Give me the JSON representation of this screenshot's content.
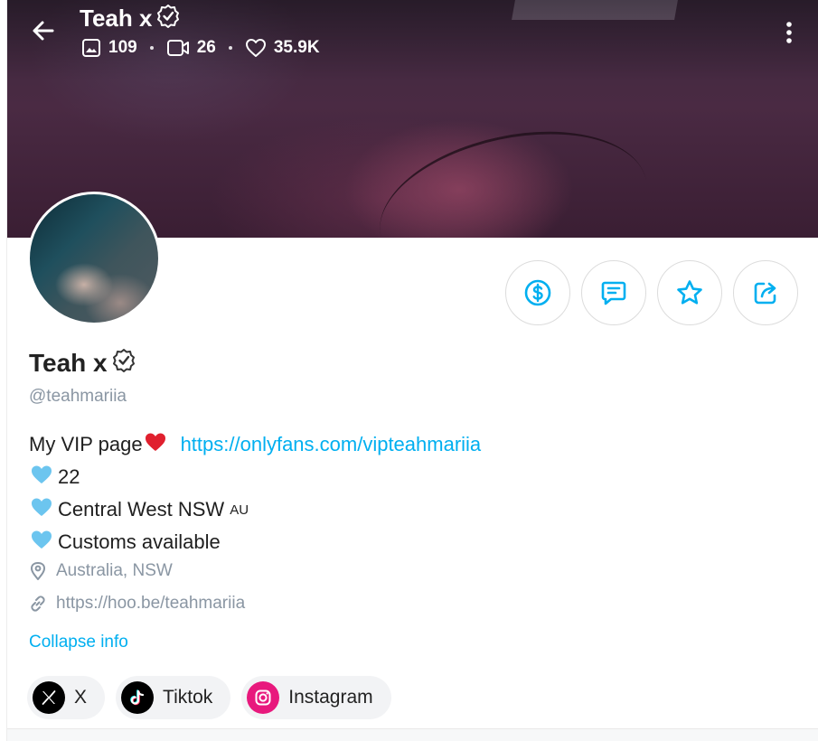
{
  "header": {
    "name": "Teah x",
    "stats": {
      "photos": "109",
      "videos": "26",
      "likes": "35.9K"
    }
  },
  "profile": {
    "name": "Teah x",
    "handle": "@teahmariia"
  },
  "bio": {
    "line1_text": "My VIP page",
    "line1_link": "https://onlyfans.com/vipteahmariia",
    "line2": "22",
    "line3": "Central West NSW",
    "line3_flag": "AU",
    "line4": "Customs available"
  },
  "location": "Australia, NSW",
  "website": "https://hoo.be/teahmariia",
  "collapse_label": "Collapse info",
  "socials": [
    {
      "label": "X",
      "icon": "x-icon"
    },
    {
      "label": "Tiktok",
      "icon": "tiktok-icon"
    },
    {
      "label": "Instagram",
      "icon": "instagram-icon"
    }
  ],
  "colors": {
    "accent": "#00aff0",
    "muted": "#8a96a3",
    "heart_red": "#e0202e",
    "heart_blue": "#6cc5ef",
    "instagram": "#e8197d"
  },
  "icons": [
    "back-arrow-icon",
    "verified-icon",
    "image-icon",
    "video-icon",
    "heart-icon",
    "more-vertical-icon",
    "dollar-icon",
    "message-icon",
    "star-icon",
    "share-icon",
    "location-pin-icon",
    "link-icon"
  ]
}
